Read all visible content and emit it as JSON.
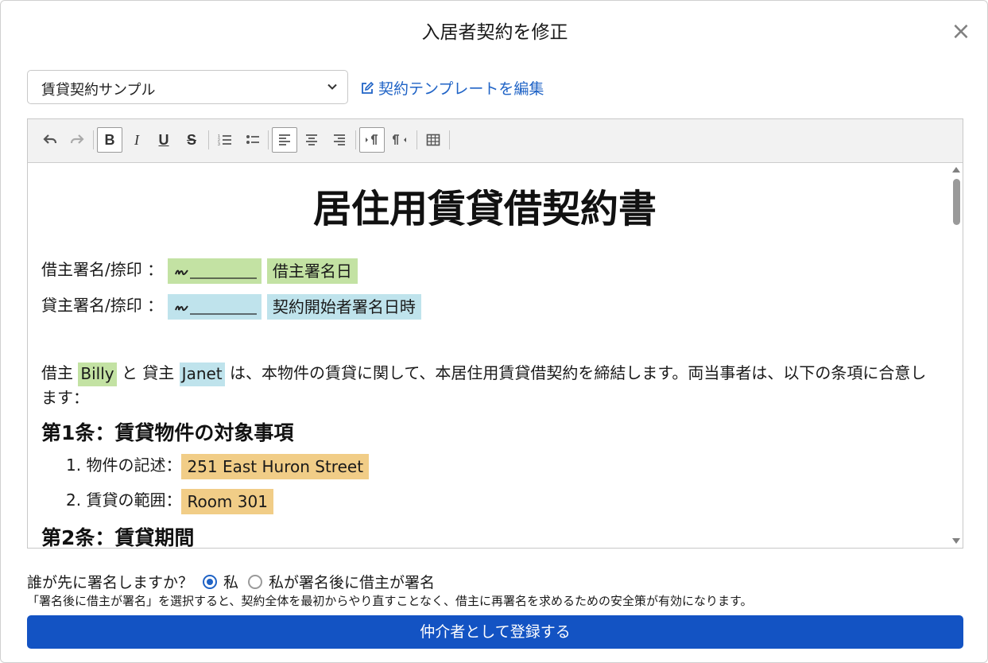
{
  "modal": {
    "title": "入居者契約を修正",
    "close_label": "×"
  },
  "template_select": {
    "value": "賃貸契約サンプル"
  },
  "edit_template_link": "契約テンプレートを編集",
  "toolbar": {
    "bold": "B",
    "italic": "I",
    "underline": "U",
    "strike": "S"
  },
  "document": {
    "title": "居住用賃貸借契約書",
    "tenant_sign_label": "借主署名/捺印 ：",
    "tenant_sign_date": "借主署名日",
    "landlord_sign_label": "貸主署名/捺印 ：",
    "landlord_sign_date": "契約開始者署名日時",
    "intro": {
      "p1": "借主",
      "tenant_name": "Billy",
      "p2": "と 貸主",
      "landlord_name": "Janet",
      "p3": "は、本物件の賃貸に関して、本居住用賃貸借契約を締結します。両当事者は、以下の条項に合意します："
    },
    "article1": {
      "heading": "第1条：賃貸物件の対象事項",
      "item1_label": "1. 物件の記述：",
      "item1_value": "251 East Huron Street",
      "item2_label": "2. 賃貸の範囲：",
      "item2_value": "Room 301"
    },
    "article2": {
      "heading": "第2条：賃貸期間"
    }
  },
  "signing_order": {
    "question": "誰が先に署名しますか？",
    "option_me": "私",
    "option_after": "私が署名後に借主が署名",
    "selected": "私",
    "note": "「署名後に借主が署名」を選択すると、契約全体を最初からやり直すことなく、借主に再署名を求めるための安全策が有効になります。"
  },
  "submit_button": "仲介者として登録する",
  "colors": {
    "primary": "#1353c3",
    "link": "#1f63c6",
    "tenant_highlight": "#c3e2a3",
    "landlord_highlight": "#bfe3ec",
    "property_highlight": "#f1cd87"
  }
}
